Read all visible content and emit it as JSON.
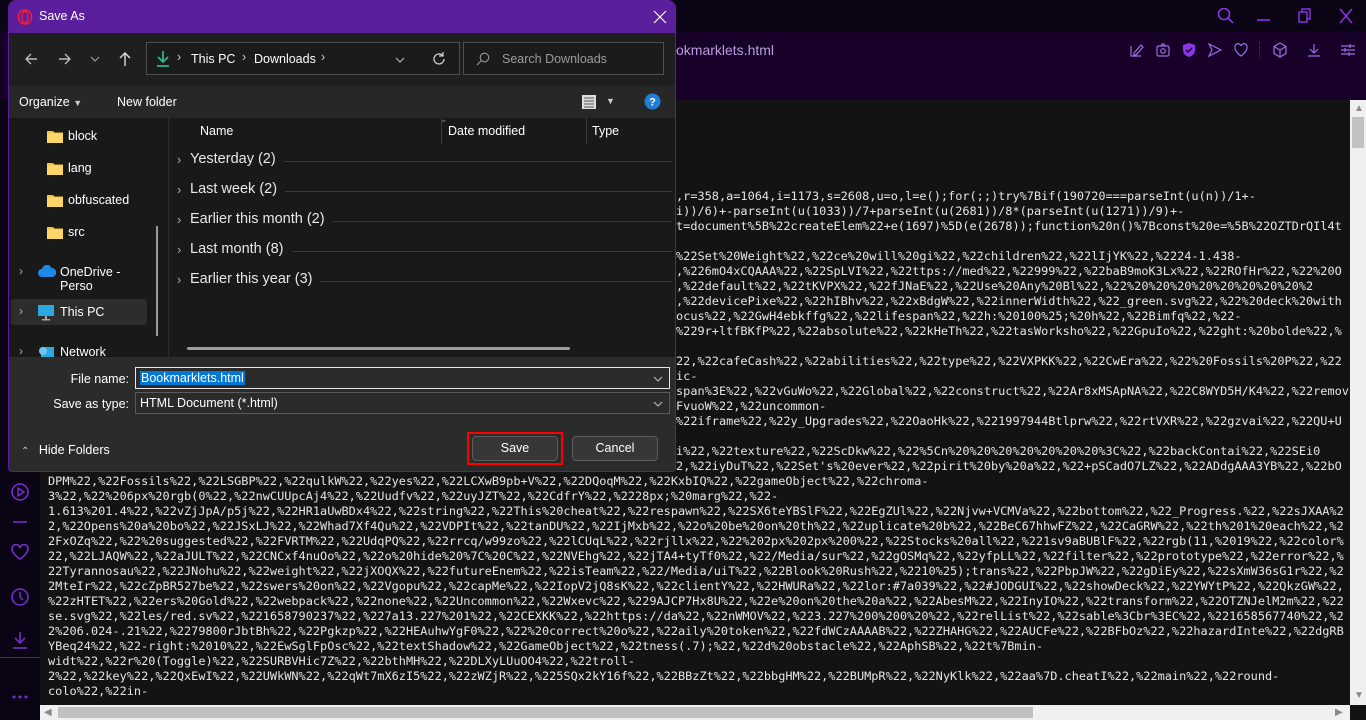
{
  "browser": {
    "tab_title": "okmarklets.html",
    "accent": "#8a35e8",
    "toolbar_icons": [
      "edit-snapshot-icon",
      "camera-icon",
      "vpn-shield-icon",
      "send-icon",
      "heart-icon",
      "cube-icon",
      "download-icon",
      "easy-setup-icon"
    ],
    "window_controls": [
      "search-icon",
      "minimize-icon",
      "restore-icon",
      "close-icon"
    ],
    "sidebar_icons": [
      "player-icon",
      "minus-icon",
      "heart-icon",
      "history-clock-icon",
      "download-icon",
      "more-icon"
    ]
  },
  "code_lines": [
    {
      "partial": true,
      "text": ",r=358,a=1064,i=1173,s=2608,u=o,l=e();for(;;)try%7Bif(190720===parseInt(u(n))/1+-"
    },
    {
      "partial": true,
      "text": "i))/6)+-parseInt(u(1033))/7+parseInt(u(2681))/8*(parseInt(u(1271))/9)+-"
    },
    {
      "partial": true,
      "text": "t=document%5B%22createElem%22+e(1697)%5D(e(2678));function%20n()%7Bconst%20e=%5B%22OZTDrQIl4t"
    },
    {
      "partial": true,
      "text": ""
    },
    {
      "partial": true,
      "text": "%22Set%20Weight%22,%22ce%20will%20gi%22,%22children%22,%22lIjYK%22,%2224-1.438-"
    },
    {
      "partial": true,
      "text": ",%226mO4xCQAAA%22,%22SpLVI%22,%22ttps://med%22,%22999%22,%22baB9moK3Lx%22,%22ROfHr%22,%22%20O"
    },
    {
      "partial": true,
      "text": ",%22default%22,%22tKVPX%22,%22fJNaE%22,%22Use%20Any%20Bl%22,%22%20%20%20%20%20%20%20%20%2"
    },
    {
      "partial": true,
      "text": ",%22devicePixe%22,%22hIBhv%22,%22xBdgW%22,%22innerWidth%22,%22_green.svg%22,%22%20deck%20with"
    },
    {
      "partial": true,
      "text": "ocus%22,%22GwH4ebkffg%22,%22lifespan%22,%22h:%20100%25;%20h%22,%22Bimfq%22,%22-"
    },
    {
      "partial": true,
      "text": "%229r+ltfBKfP%22,%22absolute%22,%22kHeTh%22,%22tasWorksho%22,%22GpuIo%22,%22ght:%20bolde%22,%"
    },
    {
      "partial": true,
      "text": ""
    },
    {
      "partial": true,
      "text": "22,%22cafeCash%22,%22abilities%22,%22type%22,%22VXPKK%22,%22CwEra%22,%22%20Fossils%20P%22,%22"
    },
    {
      "partial": true,
      "text": "ic-"
    },
    {
      "partial": true,
      "text": "span%3E%22,%22vGuWo%22,%22Global%22,%22construct%22,%22Ar8xMSApNA%22,%22C8WYD5H/K4%22,%22remov"
    },
    {
      "partial": true,
      "text": "FvuoW%22,%22uncommon-"
    },
    {
      "partial": true,
      "text": "%22iframe%22,%22y_Upgrades%22,%22OaoHk%22,%221997944Btlprw%22,%22rtVXR%22,%22gzvai%22,%22QU+U"
    },
    {
      "partial": true,
      "text": ""
    },
    {
      "partial": true,
      "text": "i%22,%22texture%22,%22ScDkw%22,%22%5Cn%20%20%20%20%20%20%20%3C%22,%22backContai%22,%22SEi0"
    },
    {
      "partial": true,
      "text": "2,%22iyDuT%22,%22Set's%20ever%22,%22pirit%20by%20a%22,%22+pSCadO7LZ%22,%22ADdgAAA3YB%22,%22bO"
    },
    {
      "partial": false,
      "text": "DPM%22,%22Fossils%22,%22LSGBP%22,%22qulkW%22,%22yes%22,%22LCXwB9pb+V%22,%22DQoqM%22,%22KxbIQ%22,%22gameObject%22,%22chroma-"
    },
    {
      "partial": false,
      "text": "3%22,%22%206px%20rgb(0%22,%22nwCUUpcAj4%22,%22Uudfv%22,%22uyJZT%22,%22CdfrY%22,%2228px;%20marg%22,%22-"
    },
    {
      "partial": false,
      "text": "1.613%201.4%22,%22vZjJpA/p5j%22,%22HR1aUwBDx4%22,%22string%22,%22This%20cheat%22,%22respawn%22,%22SX6teYBSlF%22,%22EgZUl%22,%22Njvw+VCMVa%22,%22bottom%22,%22_Progress.%22,%22sJXAA%2"
    },
    {
      "partial": false,
      "text": "2,%22Opens%20a%20bo%22,%22JSxLJ%22,%22Whad7Xf4Qu%22,%22VDPIt%22,%22tanDU%22,%22IjMxb%22,%22o%20be%20on%20th%22,%22uplicate%20b%22,%22BeC67hhwFZ%22,%22CaGRW%22,%22th%201%20each%22,%2"
    },
    {
      "partial": false,
      "text": "2FxOZq%22,%22%20suggested%22,%22FVRTM%22,%22UdqPQ%22,%22rrcq/w99zo%22,%22lCUqL%22,%22rjllx%22,%22%202px%202px%200%22,%22Stocks%20all%22,%221sv9aBUBlF%22,%22rgb(11,%2019%22,%22color%"
    },
    {
      "partial": false,
      "text": "22,%22LJAQW%22,%22aJULT%22,%22CNCxf4nuOo%22,%22o%20hide%20%7C%20C%22,%22NVEhg%22,%22jTA4+tyTf0%22,%22/Media/sur%22,%22gOSMq%22,%22yfpLL%22,%22filter%22,%22prototype%22,%22error%22,%"
    },
    {
      "partial": false,
      "text": "22Tyrannosau%22,%22JNohu%22,%22weight%22,%22jXOQX%22,%22futureEnem%22,%22isTeam%22,%22/Media/uiT%22,%22Blook%20Rush%22,%2210%25);trans%22,%22PbpJW%22,%22gDiEy%22,%22sXmW36sG1r%22,%2"
    },
    {
      "partial": false,
      "text": "2MteIr%22,%22cZpBR527be%22,%22swers%20on%22,%22Vgopu%22,%22capMe%22,%22IopV2jQ8sK%22,%22clientY%22,%22HWURa%22,%22lor:#7a039%22,%22#JODGUI%22,%22showDeck%22,%22YWYtP%22,%22QkzGW%22,"
    },
    {
      "partial": false,
      "text": "%22zHTET%22,%22ers%20Gold%22,%22webpack%22,%22none%22,%22Uncommon%22,%22Wxevc%22,%229AJCP7Hx8U%22,%22e%20on%20the%20a%22,%22AbesM%22,%22InyIO%22,%22transform%22,%22OTZNJelM2m%22,%22"
    },
    {
      "partial": false,
      "text": "se.svg%22,%22les/red.sv%22,%221658790237%22,%227a13.227%201%22,%22CEXKK%22,%22https://da%22,%22nWMOV%22,%223.227%200%200%20%22,%22relList%22,%22sable%3Cbr%3EC%22,%221658567740%22,%2"
    },
    {
      "partial": false,
      "text": "2%206.024-.21%22,%2279800rJbtBh%22,%22Pgkzp%22,%22HEAuhwYgF0%22,%22%20correct%20o%22,%22aily%20token%22,%22fdWCzAAAAB%22,%22ZHAHG%22,%22AUCFe%22,%22BFbOz%22,%22hazardInte%22,%22dgRB"
    },
    {
      "partial": false,
      "text": "YBeq24%22,%22-right:%2010%22,%22EwSglFpOsc%22,%22textShadow%22,%22GameObject%22,%22tness(.7);%22,%22d%20obstacle%22,%22AphSB%22,%22t%7Bmin-"
    },
    {
      "partial": false,
      "text": "widt%22,%22r%20(Toggle)%22,%22SURBVHic7Z%22,%22bthMH%22,%22DLXyLUuOO4%22,%22troll-"
    },
    {
      "partial": false,
      "text": "2%22,%22key%22,%22QxEwI%22,%22UWkWN%22,%22qWt7mX6zI5%22,%22zWZjR%22,%225SQx2kY16f%22,%22BBzZt%22,%22bbgHM%22,%22BUMpR%22,%22NyKlk%22,%22aa%7D.cheatI%22,%22main%22,%22round-"
    },
    {
      "partial": false,
      "text": "colo%22,%22in-"
    }
  ],
  "dialog": {
    "title": "Save As",
    "title_color": "#5b1e9c",
    "breadcrumb": [
      "This PC",
      "Downloads"
    ],
    "search_placeholder": "Search Downloads",
    "organize_label": "Organize",
    "new_folder_label": "New folder",
    "nav_items": [
      {
        "label": "block",
        "icon": "folder-icon"
      },
      {
        "label": "lang",
        "icon": "folder-icon"
      },
      {
        "label": "obfuscated",
        "icon": "folder-icon"
      },
      {
        "label": "src",
        "icon": "folder-icon"
      },
      {
        "label": "OneDrive - Perso",
        "icon": "cloud-icon"
      },
      {
        "label": "This PC",
        "icon": "computer-icon",
        "selected": true
      },
      {
        "label": "Network",
        "icon": "network-icon"
      }
    ],
    "columns": [
      "Name",
      "Date modified",
      "Type"
    ],
    "groups": [
      "Yesterday (2)",
      "Last week (2)",
      "Earlier this month (2)",
      "Last month (8)",
      "Earlier this year (3)"
    ],
    "file_name_label": "File name:",
    "file_name_value": "Bookmarklets.html",
    "save_type_label": "Save as type:",
    "save_type_value": "HTML Document (*.html)",
    "hide_folders_label": "Hide Folders",
    "save_label": "Save",
    "cancel_label": "Cancel",
    "highlight_color": "#ff0000"
  }
}
